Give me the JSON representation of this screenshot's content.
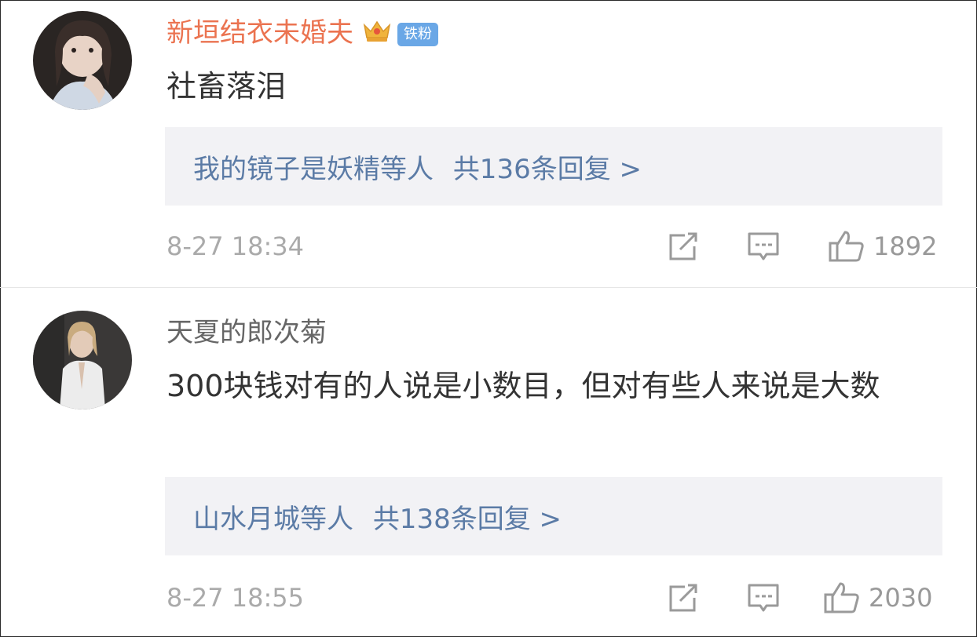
{
  "comments": [
    {
      "username": "新垣结衣未婚夫",
      "badge": "铁粉",
      "text": "社畜落泪",
      "reply_users": "我的镜子是妖精等人",
      "reply_count": "共136条回复 >",
      "time": "8-27 18:34",
      "likes": "1892"
    },
    {
      "username": "天夏的郎次菊",
      "text": "300块钱对有的人说是小数目，但对有些人来说是大数",
      "reply_users": "山水月城等人",
      "reply_count": "共138条回复 >",
      "time": "8-27 18:55",
      "likes": "2030"
    }
  ],
  "colors": {
    "vip_name": "#eb7350",
    "link": "#5b7ba6",
    "reply_bg": "#f2f2f5",
    "meta": "#aaaaaa",
    "badge": "#6aa7e6"
  },
  "icons": {
    "vip": "crown-icon",
    "share": "share-icon",
    "comment": "comment-icon",
    "like": "thumbs-up-icon"
  }
}
